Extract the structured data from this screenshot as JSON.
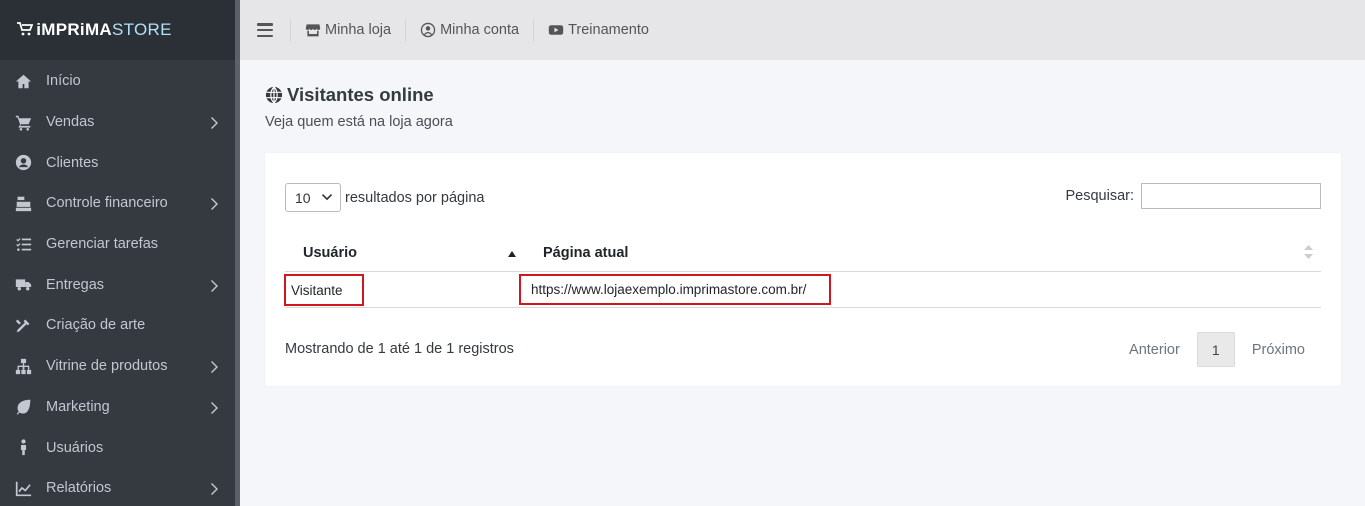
{
  "brand": {
    "logo_bold": "iMPRiMA",
    "logo_light": "STORE"
  },
  "sidebar": {
    "items": [
      {
        "label": "Início",
        "icon": "home-icon",
        "has_submenu": false
      },
      {
        "label": "Vendas",
        "icon": "cart-icon",
        "has_submenu": true
      },
      {
        "label": "Clientes",
        "icon": "user-circle-icon",
        "has_submenu": false
      },
      {
        "label": "Controle financeiro",
        "icon": "cash-register-icon",
        "has_submenu": true
      },
      {
        "label": "Gerenciar tarefas",
        "icon": "tasks-icon",
        "has_submenu": false
      },
      {
        "label": "Entregas",
        "icon": "truck-icon",
        "has_submenu": true
      },
      {
        "label": "Criação de arte",
        "icon": "tools-icon",
        "has_submenu": false
      },
      {
        "label": "Vitrine de produtos",
        "icon": "sitemap-icon",
        "has_submenu": true
      },
      {
        "label": "Marketing",
        "icon": "leaf-icon",
        "has_submenu": true
      },
      {
        "label": "Usuários",
        "icon": "male-icon",
        "has_submenu": false
      },
      {
        "label": "Relatórios",
        "icon": "chart-line-icon",
        "has_submenu": true
      }
    ]
  },
  "topbar": {
    "links": [
      {
        "label": "Minha loja",
        "icon": "store-icon"
      },
      {
        "label": "Minha conta",
        "icon": "user-circle-icon"
      },
      {
        "label": "Treinamento",
        "icon": "youtube-icon"
      }
    ]
  },
  "page": {
    "title": "Visitantes online",
    "subtitle": "Veja quem está na loja agora"
  },
  "table_controls": {
    "page_length": "10",
    "page_length_label": "resultados por página",
    "search_label": "Pesquisar:",
    "search_value": ""
  },
  "table": {
    "columns": [
      "Usuário",
      "Página atual"
    ],
    "rows": [
      {
        "user": "Visitante",
        "page": "https://www.lojaexemplo.imprimastore.com.br/"
      }
    ]
  },
  "footer": {
    "info": "Mostrando de 1 até 1 de 1 registros",
    "prev_label": "Anterior",
    "current_page": "1",
    "next_label": "Próximo"
  },
  "colors": {
    "sidebar_bg": "#343a40",
    "topbar_bg": "#e6e6e9",
    "content_bg": "#f4f6f9",
    "highlight_border": "#d0161e"
  }
}
